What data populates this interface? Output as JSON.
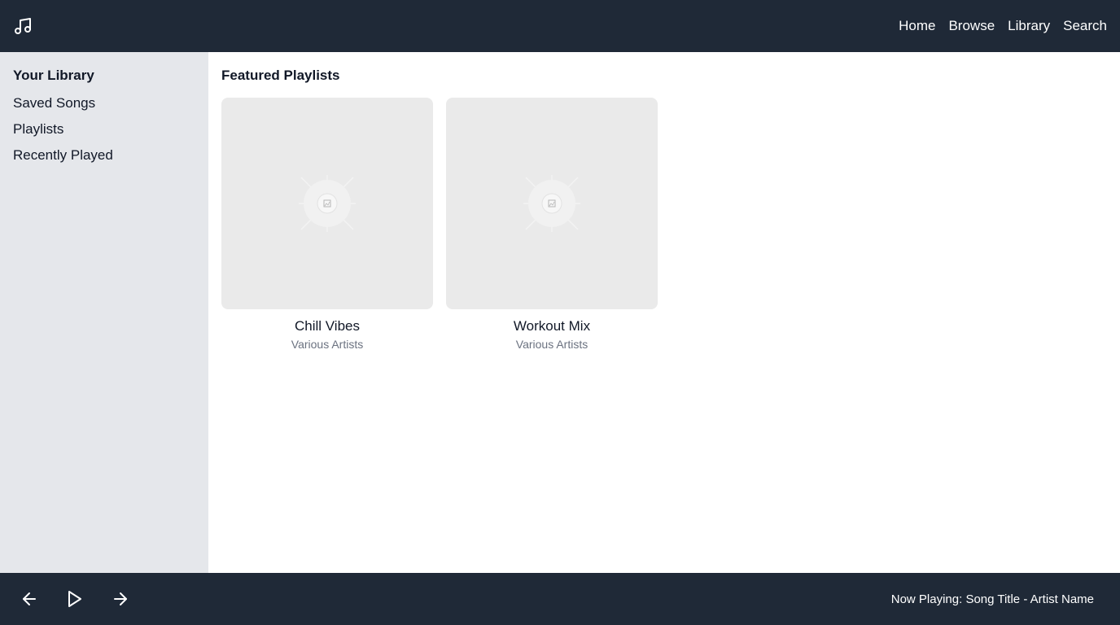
{
  "header": {
    "logo_icon": "music-note-icon",
    "nav": [
      {
        "label": "Home"
      },
      {
        "label": "Browse"
      },
      {
        "label": "Library"
      },
      {
        "label": "Search"
      }
    ]
  },
  "sidebar": {
    "title": "Your Library",
    "items": [
      {
        "label": "Saved Songs"
      },
      {
        "label": "Playlists"
      },
      {
        "label": "Recently Played"
      }
    ]
  },
  "main": {
    "title": "Featured Playlists",
    "playlists": [
      {
        "title": "Chill Vibes",
        "subtitle": "Various Artists",
        "cover_icon": "image-placeholder-icon"
      },
      {
        "title": "Workout Mix",
        "subtitle": "Various Artists",
        "cover_icon": "image-placeholder-icon"
      }
    ]
  },
  "player": {
    "prev_icon": "arrow-left-icon",
    "play_icon": "play-icon",
    "next_icon": "arrow-right-icon",
    "now_playing": "Now Playing: Song Title - Artist Name"
  },
  "colors": {
    "bar_background": "#1f2937",
    "sidebar_background": "#e5e7eb",
    "cover_placeholder": "#eaeaea",
    "muted_text": "#6b7280"
  }
}
